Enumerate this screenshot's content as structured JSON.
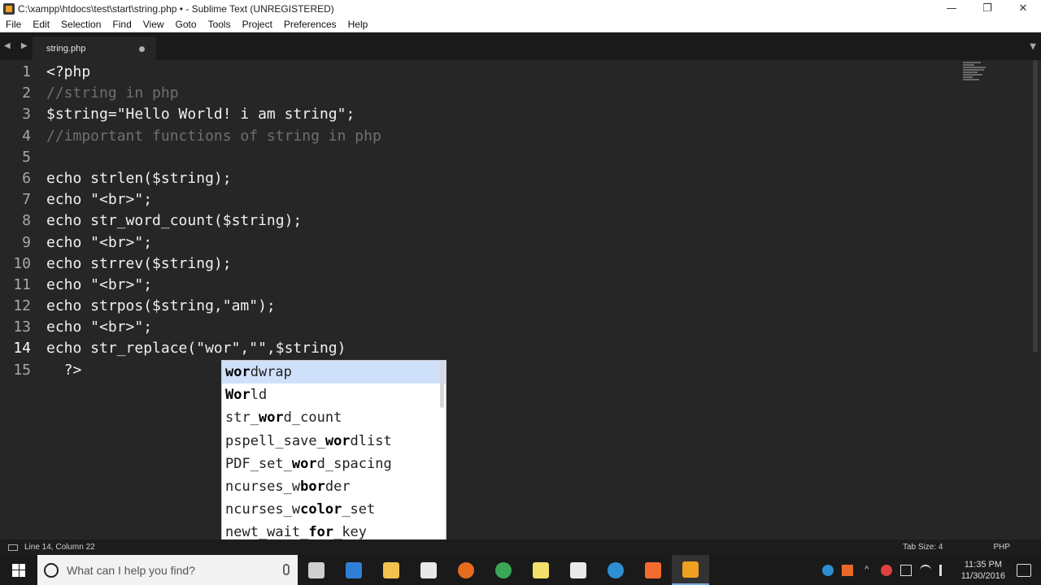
{
  "window": {
    "title": "C:\\xampp\\htdocs\\test\\start\\string.php • - Sublime Text (UNREGISTERED)",
    "minimize_glyph": "—",
    "maximize_glyph": "❐",
    "close_glyph": "✕"
  },
  "menu": {
    "items": [
      "File",
      "Edit",
      "Selection",
      "Find",
      "View",
      "Goto",
      "Tools",
      "Project",
      "Preferences",
      "Help"
    ]
  },
  "tabs": [
    {
      "label": "string.php",
      "dirty": true
    }
  ],
  "tab_nav_glyphs": "◀ ▶",
  "tab_dropdown_glyph": "▼",
  "editor": {
    "active_line": 14,
    "lines": [
      {
        "num": "1",
        "text": "<?php",
        "kind": "code"
      },
      {
        "num": "2",
        "text": "//string in php",
        "kind": "comment"
      },
      {
        "num": "3",
        "text": "$string=\"Hello World! i am string\";",
        "kind": "code"
      },
      {
        "num": "4",
        "text": "//important functions of string in php",
        "kind": "comment"
      },
      {
        "num": "5",
        "text": "",
        "kind": "code"
      },
      {
        "num": "6",
        "text": "echo strlen($string);",
        "kind": "code"
      },
      {
        "num": "7",
        "text": "echo \"<br>\";",
        "kind": "code"
      },
      {
        "num": "8",
        "text": "echo str_word_count($string);",
        "kind": "code"
      },
      {
        "num": "9",
        "text": "echo \"<br>\";",
        "kind": "code"
      },
      {
        "num": "10",
        "text": "echo strrev($string);",
        "kind": "code"
      },
      {
        "num": "11",
        "text": "echo \"<br>\";",
        "kind": "code"
      },
      {
        "num": "12",
        "text": "echo strpos($string,\"am\");",
        "kind": "code"
      },
      {
        "num": "13",
        "text": "echo \"<br>\";",
        "kind": "code"
      },
      {
        "num": "14",
        "text": "echo str_replace(\"wor\",\"\",$string)",
        "kind": "code"
      },
      {
        "num": "15",
        "text": "  ?>",
        "kind": "code"
      }
    ]
  },
  "autocomplete": {
    "selected_index": 0,
    "items": [
      {
        "pre": "",
        "match": "wor",
        "post": "dwrap"
      },
      {
        "pre": "",
        "match": "Wor",
        "post": "ld"
      },
      {
        "pre": "str_",
        "match": "wor",
        "post": "d_count"
      },
      {
        "pre": "pspell_save_",
        "match": "wor",
        "post": "dlist"
      },
      {
        "pre": "PDF_set_",
        "match": "wor",
        "post": "d_spacing"
      },
      {
        "pre": "ncurses_w",
        "match": "bor",
        "post": "der"
      },
      {
        "pre": "ncurses_w",
        "match": "color",
        "post": "_set"
      },
      {
        "pre": "newt_wait_",
        "match": "for",
        "post": "_key"
      }
    ]
  },
  "status": {
    "position": "Line 14, Column 22",
    "tab_size": "Tab Size: 4",
    "syntax": "PHP"
  },
  "taskbar": {
    "search_placeholder": "What can I help you find?",
    "apps": [
      {
        "name": "task-view-icon",
        "color": "#cfcfcf"
      },
      {
        "name": "edge-icon",
        "color": "#2f7fd6"
      },
      {
        "name": "file-explorer-icon",
        "color": "#f2c14e"
      },
      {
        "name": "store-icon",
        "color": "#e8e8e8"
      },
      {
        "name": "firefox-icon",
        "color": "#e66b1f"
      },
      {
        "name": "chrome-icon",
        "color": "#3aa757"
      },
      {
        "name": "sticky-notes-icon",
        "color": "#f3e06a"
      },
      {
        "name": "xampp-tool-icon",
        "color": "#e9e9e9"
      },
      {
        "name": "chat-icon",
        "color": "#2d8fd1"
      },
      {
        "name": "xampp-icon",
        "color": "#f46b2f"
      },
      {
        "name": "sublime-text-icon",
        "color": "#f0a020"
      }
    ],
    "clock_time": "11:35 PM",
    "clock_date": "11/30/2016"
  },
  "colors": {
    "editor_bg": "#262626",
    "accent_selection": "#cfe0fb",
    "comment": "#6f6f6f"
  }
}
